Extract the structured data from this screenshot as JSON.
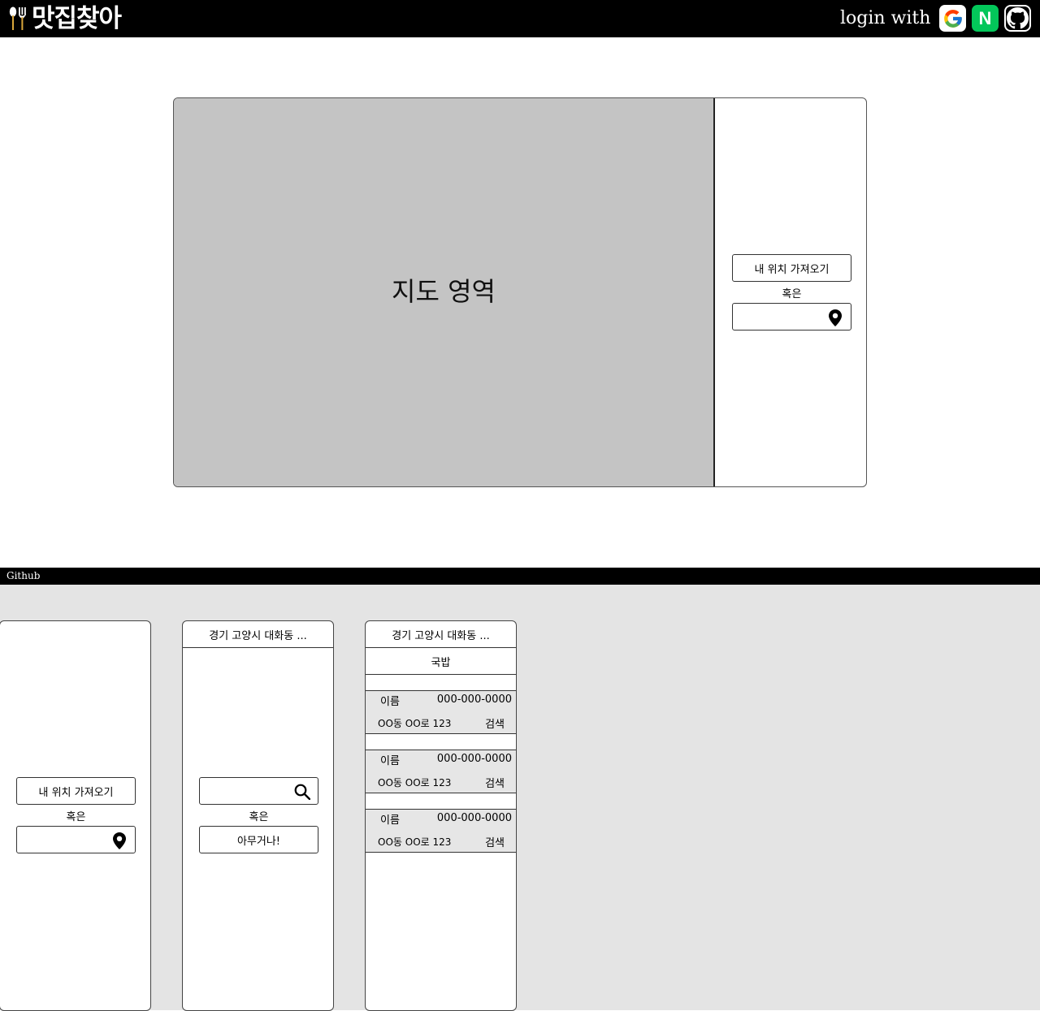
{
  "header": {
    "logo_text": "맛집찾아",
    "logo_icon": "spoon-fork-icon",
    "login_label": "login with",
    "social": [
      {
        "name": "google",
        "icon": "google-icon",
        "color": "#4285f4"
      },
      {
        "name": "naver",
        "icon": "naver-icon",
        "label": "N",
        "color": "#03c75a"
      },
      {
        "name": "github",
        "icon": "github-icon",
        "color": "#000000"
      }
    ]
  },
  "main": {
    "map_label": "지도 영역",
    "get_location_label": "내 위치 가져오기",
    "or_label": "혹은",
    "location_input_value": "",
    "location_icon": "map-pin-icon"
  },
  "footer": {
    "link_label": "Github"
  },
  "mobile": {
    "screen1": {
      "get_location_label": "내 위치 가져오기",
      "or_label": "혹은",
      "location_input_value": "",
      "location_icon": "map-pin-icon"
    },
    "screen2": {
      "address": "경기 고양시 대화동 ...",
      "search_input_value": "",
      "search_icon": "search-icon",
      "or_label": "혹은",
      "random_label": "아무거나!"
    },
    "screen3": {
      "address": "경기 고양시 대화동 ...",
      "category": "국밥",
      "results": [
        {
          "name": "이름",
          "phone": "000-000-0000",
          "address": "OO동 OO로 123",
          "search_label": "검색"
        },
        {
          "name": "이름",
          "phone": "000-000-0000",
          "address": "OO동 OO로 123",
          "search_label": "검색"
        },
        {
          "name": "이름",
          "phone": "000-000-0000",
          "address": "OO동 OO로 123",
          "search_label": "검색"
        }
      ]
    }
  },
  "colors": {
    "header_bg": "#000000",
    "map_bg": "#c4c4c4",
    "mobile_section_bg": "#e4e4e4",
    "result_card_bg": "#e6e6e6",
    "naver_green": "#03c75a"
  }
}
